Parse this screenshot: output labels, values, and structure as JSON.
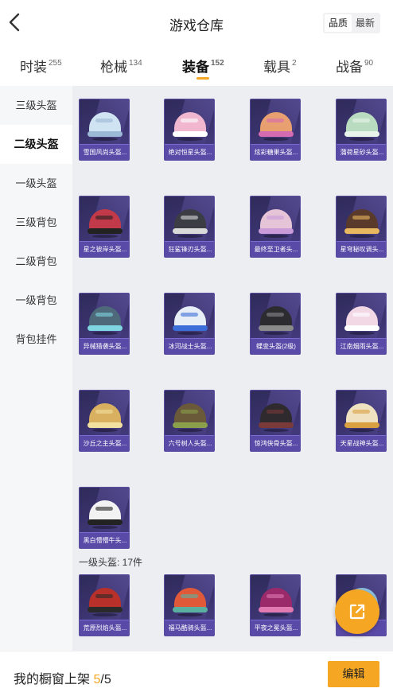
{
  "header": {
    "title": "游戏仓库",
    "sort_options": [
      "品质",
      "最新"
    ],
    "sort_active": "品质"
  },
  "tabs": [
    {
      "label": "时装",
      "count": "255"
    },
    {
      "label": "枪械",
      "count": "134"
    },
    {
      "label": "装备",
      "count": "152",
      "active": true
    },
    {
      "label": "载具",
      "count": "2"
    },
    {
      "label": "战备",
      "count": "90"
    }
  ],
  "sidebar": {
    "items": [
      {
        "label": "三级头盔"
      },
      {
        "label": "二级头盔",
        "active": true
      },
      {
        "label": "一级头盔"
      },
      {
        "label": "三级背包"
      },
      {
        "label": "二级背包"
      },
      {
        "label": "一级背包"
      },
      {
        "label": "背包挂件"
      }
    ]
  },
  "grid": {
    "items": [
      {
        "name": "雪国风尚头盔...",
        "color": "#cfe3f2",
        "accent": "#9bb8d6"
      },
      {
        "name": "绝对恒星头盔...",
        "color": "#f0b7cf",
        "accent": "#ffffff"
      },
      {
        "name": "炫彩糖果头盔...",
        "color": "#e8a070",
        "accent": "#d56bb0"
      },
      {
        "name": "蒲荷星砂头盔...",
        "color": "#b9dbc0",
        "accent": "#e8f4ea"
      },
      {
        "name": "星之彼岸头盔...",
        "color": "#c23a4a",
        "accent": "#222222"
      },
      {
        "name": "狂鲨锋刃头盔...",
        "color": "#3a3d44",
        "accent": "#d9d9d9"
      },
      {
        "name": "最终至卫者头...",
        "color": "#e6c4d8",
        "accent": "#c99bd8"
      },
      {
        "name": "星穹秘叹调头...",
        "color": "#5a3a2a",
        "accent": "#e8b860"
      },
      {
        "name": "异械猎袭头盔...",
        "color": "#4e6a7a",
        "accent": "#7fd6e0"
      },
      {
        "name": "冰河战士头盔...",
        "color": "#e8eef6",
        "accent": "#3b6ed8"
      },
      {
        "name": "蝶变头盔(2级)",
        "color": "#2c2c30",
        "accent": "#8a8a8a"
      },
      {
        "name": "江南烟雨头盔...",
        "color": "#f2d8e4",
        "accent": "#ffffff"
      },
      {
        "name": "沙丘之主头盔...",
        "color": "#d8b060",
        "accent": "#f2e0a0"
      },
      {
        "name": "六号树人头盔...",
        "color": "#6a5a3a",
        "accent": "#8aa04a"
      },
      {
        "name": "惊鸿侠骨头盔...",
        "color": "#2e2a2e",
        "accent": "#7a3a3a"
      },
      {
        "name": "天星战神头盔...",
        "color": "#f0e2c0",
        "accent": "#d8a040"
      },
      {
        "name": "黑白懵懵牛头...",
        "color": "#f2f2f2",
        "accent": "#222222"
      }
    ]
  },
  "section2": {
    "label": "一级头盔: 17件",
    "items": [
      {
        "name": "荒原烈焰头盔...",
        "color": "#b8302a",
        "accent": "#2a2a2a"
      },
      {
        "name": "福马酷骑头盔...",
        "color": "#e05a3a",
        "accent": "#5ab0a0"
      },
      {
        "name": "平夜之冕头盔...",
        "color": "#9a2a6a",
        "accent": "#e07ab0"
      },
      {
        "name": "",
        "color": "#8ac0e0",
        "accent": "#d0e8f4"
      }
    ]
  },
  "footer": {
    "label": "我的橱窗上架",
    "current": "5",
    "total": "/5",
    "edit_label": "编辑"
  },
  "icons": {
    "back": "chevron-left-icon",
    "fab": "share-external-icon"
  }
}
